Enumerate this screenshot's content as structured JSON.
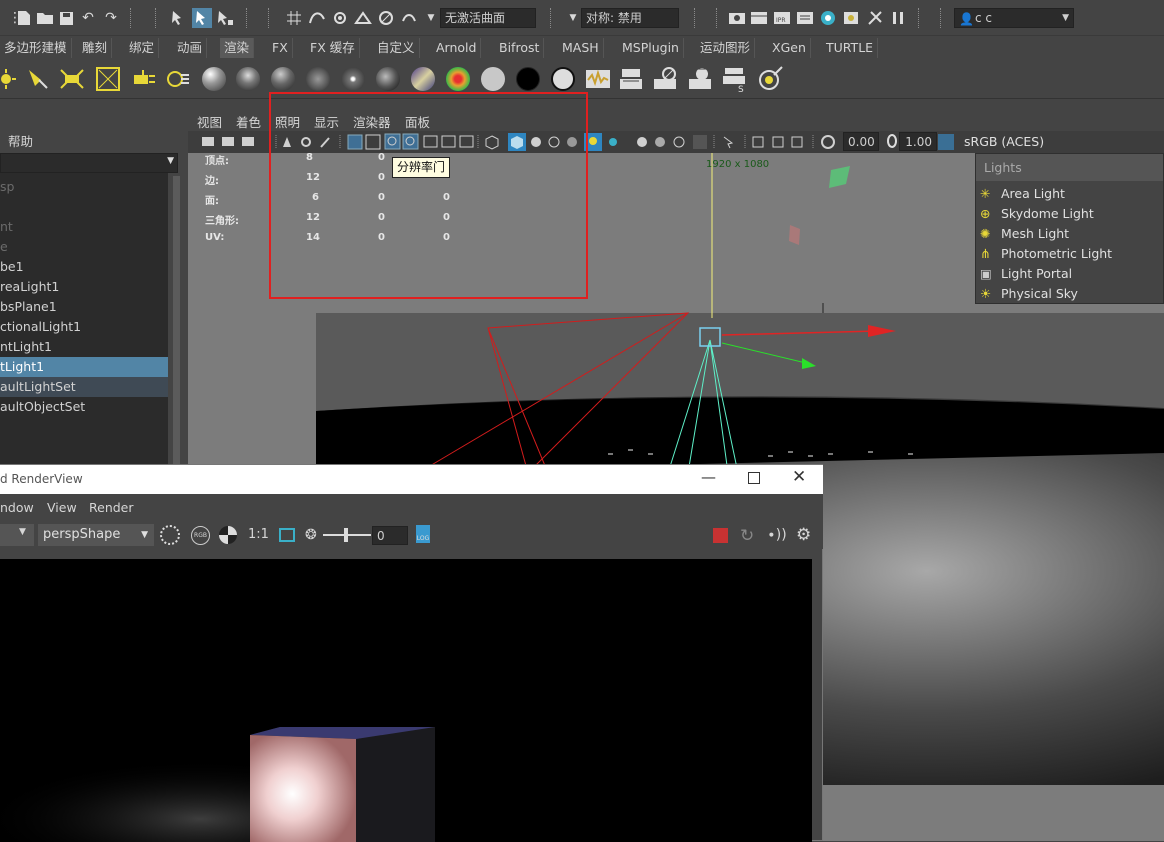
{
  "status_line": {
    "live_surface_field": "无激活曲面",
    "symmetry_field": "对称: 禁用",
    "user_field": "c c"
  },
  "shelf_tabs": [
    "多边形建模",
    "雕刻",
    "绑定",
    "动画",
    "渲染",
    "FX",
    "FX 缓存",
    "自定义",
    "Arnold",
    "Bifrost",
    "MASH",
    "MSPlugin",
    "运动图形",
    "XGen",
    "TURTLE"
  ],
  "shelf_active_tab": "渲染",
  "left_panel": {
    "help_label": "帮助",
    "outliner_items": [
      "sp",
      "",
      "nt",
      "e",
      "be1",
      "reaLight1",
      "bsPlane1",
      "ctionalLight1",
      "ntLight1",
      "tLight1",
      "aultLightSet",
      "aultObjectSet"
    ],
    "selected_item": "tLight1"
  },
  "viewport": {
    "menus": [
      "视图",
      "着色",
      "照明",
      "显示",
      "渲染器",
      "面板"
    ],
    "exposure": "0.00",
    "gamma": "1.00",
    "color_space": "sRGB (ACES)",
    "resolution_label": "1920 x 1080",
    "hud_rows": [
      {
        "label": "顶点:",
        "a": "8",
        "b": "0",
        "c": ""
      },
      {
        "label": "边:",
        "a": "12",
        "b": "0",
        "c": ""
      },
      {
        "label": "面:",
        "a": "6",
        "b": "0",
        "c": "0"
      },
      {
        "label": "三角形:",
        "a": "12",
        "b": "0",
        "c": "0"
      },
      {
        "label": "UV:",
        "a": "14",
        "b": "0",
        "c": "0"
      }
    ],
    "tooltip": "分辨率门"
  },
  "lights_menu": {
    "title": "Lights",
    "items": [
      "Area Light",
      "Skydome Light",
      "Mesh Light",
      "Photometric Light",
      "Light Portal",
      "Physical Sky"
    ]
  },
  "render_view": {
    "title": "d RenderView",
    "menus": [
      "ndow",
      "View",
      "Render"
    ],
    "camera": "perspShape",
    "ratio": "1:1",
    "exposure_value": "0",
    "log_label": "LOG",
    "rgb_label": "RGB"
  },
  "colors": {
    "highlight": "#5285a6",
    "annotation_red": "#e02020",
    "ui_bg": "#444444",
    "viewport_bg": "#7c7c7c"
  }
}
